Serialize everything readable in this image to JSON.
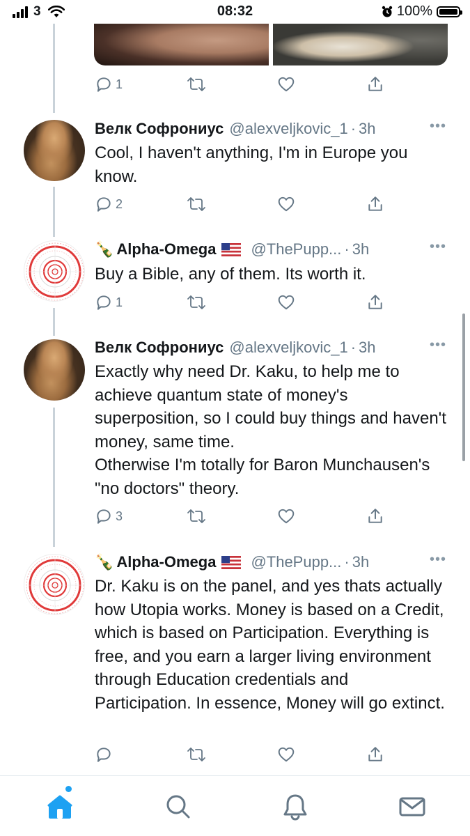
{
  "status_bar": {
    "carrier": "3",
    "time": "08:32",
    "battery": "100%"
  },
  "tweets": [
    {
      "name": "Велк Софрониус",
      "handle": "@alexveljkovic_1",
      "time": "3h",
      "text": "Cool, I haven't anything, I'm in Europe you know.",
      "replies": "2",
      "avatar": "statue-avatar"
    },
    {
      "emoji": "🍾",
      "name": "Alpha-Omega",
      "handle": "@ThePupp...",
      "time": "3h",
      "text": "Buy a Bible, any of them.  Its worth it.",
      "replies": "1",
      "avatar": "target-avatar"
    },
    {
      "name": "Велк Софрониус",
      "handle": "@alexveljkovic_1",
      "time": "3h",
      "text": "Exactly why need Dr. Kaku, to help me to achieve quantum state of money's superposition, so I could buy things and haven't money, same time.\nOtherwise I'm totally for Baron Munchausen's \"no doctors\" theory.",
      "replies": "3",
      "avatar": "statue-avatar"
    },
    {
      "emoji": "🍾",
      "name": "Alpha-Omega",
      "handle": "@ThePupp...",
      "time": "3h",
      "text": "Dr. Kaku is on the panel, and yes thats actually how Utopia works.  Money is based on a Credit, which is based on Participation.  Everything is free, and you earn a larger living environment through Education credentials and Participation.  In essence, Money will go extinct.",
      "replies": "",
      "avatar": "target-avatar"
    }
  ],
  "top_tweet_actions": {
    "replies": "1"
  },
  "tabs": [
    "home-icon",
    "search-icon",
    "notifications-icon",
    "messages-icon"
  ],
  "colors": {
    "accent": "#1da1f2",
    "muted": "#657786",
    "thread_line": "#c9d2d9"
  }
}
